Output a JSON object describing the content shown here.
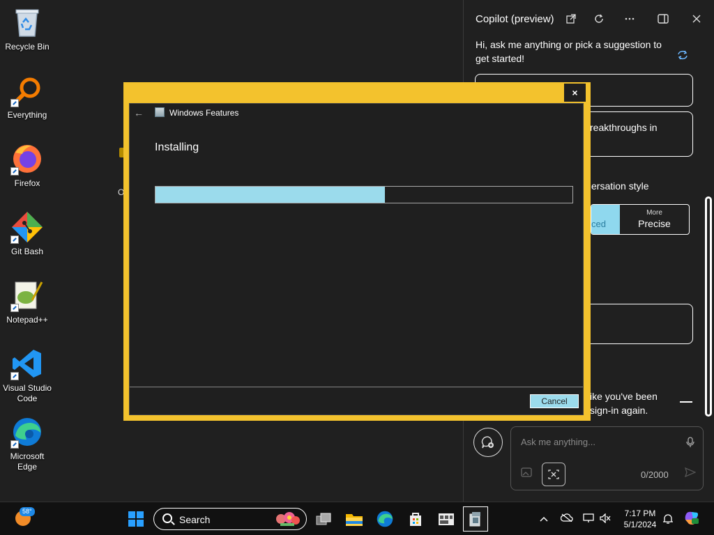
{
  "desktop": {
    "icons": [
      {
        "label": "Recycle Bin",
        "icon": "recycle-bin-icon"
      },
      {
        "label": "Everything",
        "icon": "everything-search-icon"
      },
      {
        "label": "Firefox",
        "icon": "firefox-icon"
      },
      {
        "label": "Git Bash",
        "icon": "git-bash-icon"
      },
      {
        "label": "Notepad++",
        "icon": "notepadplusplus-icon"
      },
      {
        "label": "Visual Studio Code",
        "icon": "vscode-icon"
      },
      {
        "label": "Microsoft Edge",
        "icon": "edge-icon"
      }
    ],
    "peek_text": "O"
  },
  "copilot": {
    "title": "Copilot (preview)",
    "greeting": "Hi, ask me anything or pick a suggestion to get started!",
    "suggestion_2_partial": "reakthroughs in",
    "conversation_style_partial": "ersation style",
    "style_left_partial": "ced",
    "style_more": "More",
    "style_precise": "Precise",
    "signin_line1": "ike you've been",
    "signin_line2": "sign-in again.",
    "input_placeholder": "Ask me anything...",
    "char_count": "0/2000"
  },
  "dialog": {
    "title": "Windows Features",
    "status": "Installing",
    "progress_fraction": 0.55,
    "cancel_label": "Cancel",
    "close_glyph": "×",
    "back_glyph": "←"
  },
  "taskbar": {
    "weather_temp": "58°",
    "search_label": "Search",
    "time": "7:17 PM",
    "date": "5/1/2024"
  },
  "colors": {
    "dialog_border": "#f3c22d",
    "progress_fill": "#9bdbec",
    "background": "#202020"
  }
}
